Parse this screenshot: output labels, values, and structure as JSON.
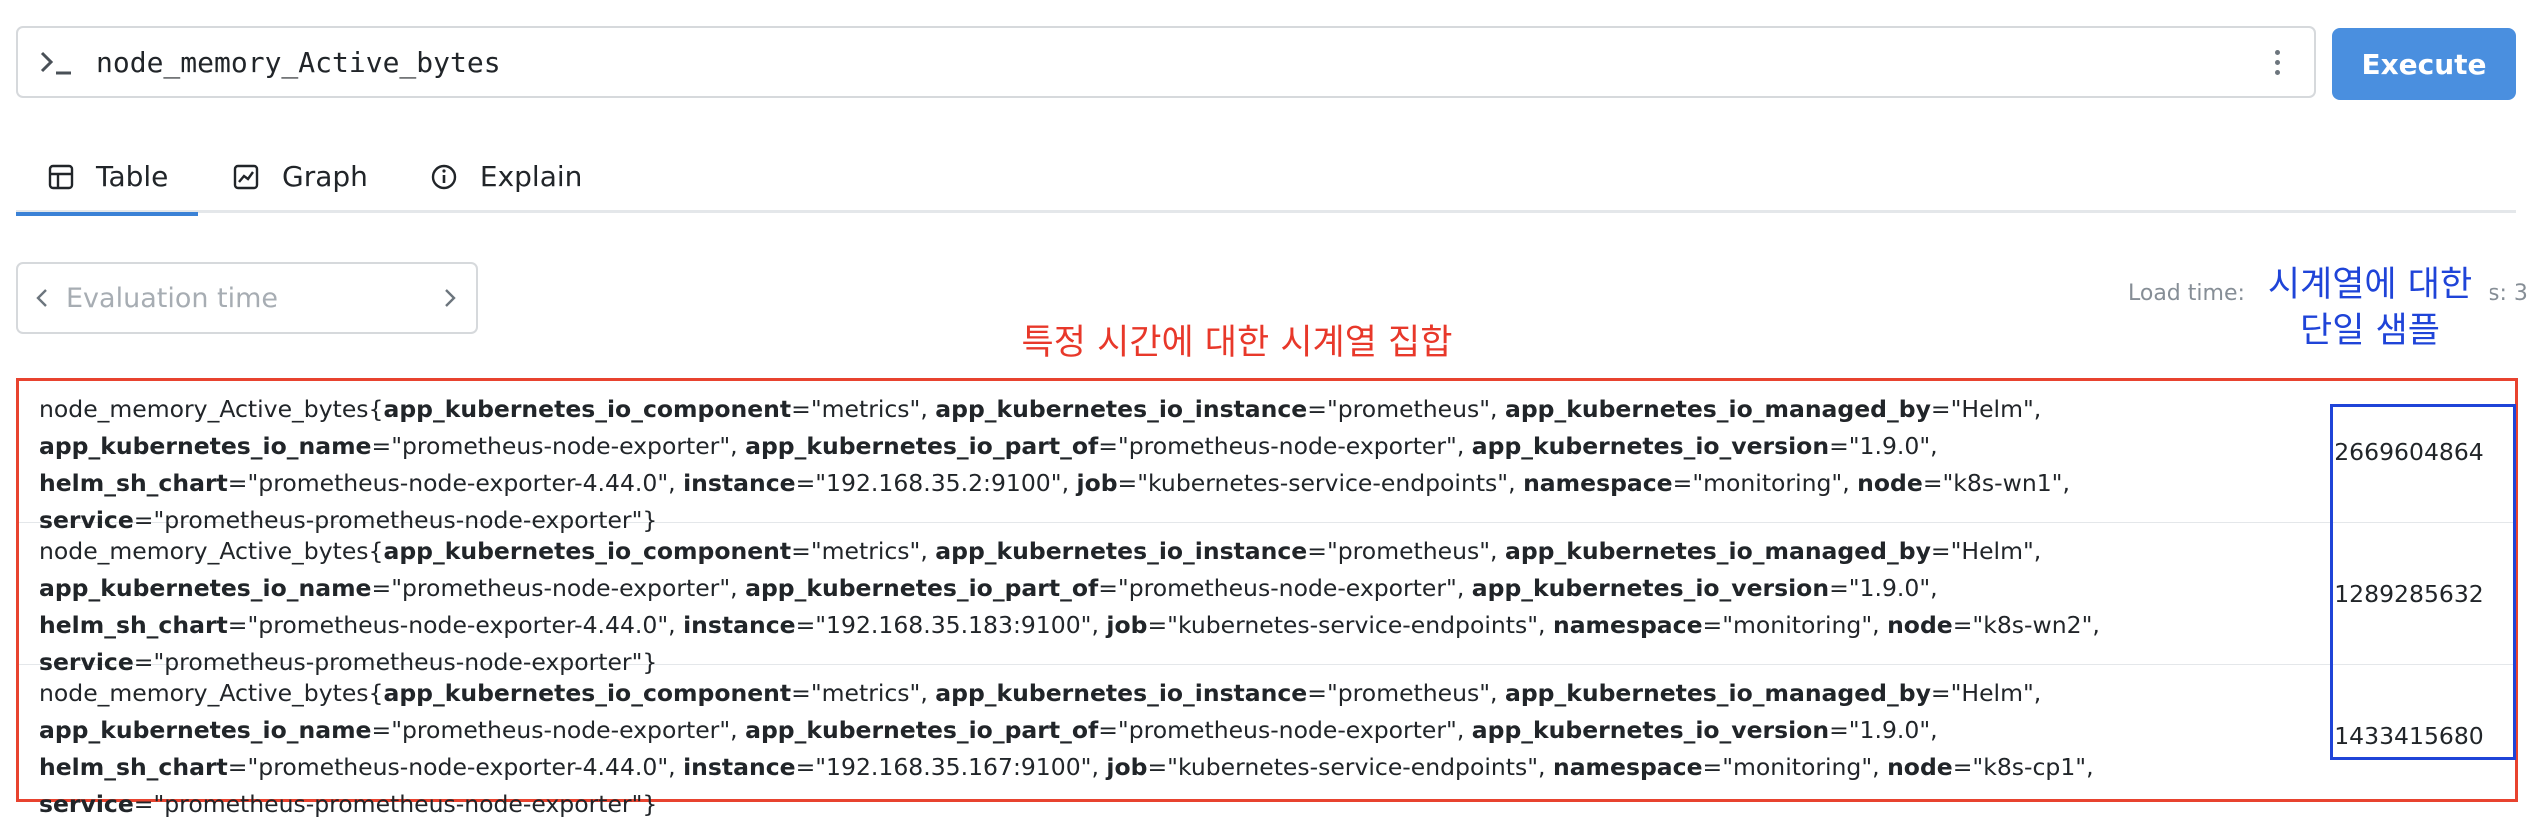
{
  "query": {
    "expression": "node_memory_Active_bytes",
    "execute_label": "Execute"
  },
  "tabs": [
    {
      "label": "Table",
      "icon": "table-icon",
      "active": true
    },
    {
      "label": "Graph",
      "icon": "graph-icon",
      "active": false
    },
    {
      "label": "Explain",
      "icon": "info-icon",
      "active": false
    }
  ],
  "evaluation": {
    "placeholder": "Evaluation time"
  },
  "stats": {
    "load_time_label": "Load time:",
    "result_series_tail": "s: 3"
  },
  "annotations": {
    "series_set": "특정 시간에 대한 시계열 집합",
    "single_sample_line1": "시계열에 대한",
    "single_sample_line2": "단일 샘플"
  },
  "rows": [
    {
      "metric": "node_memory_Active_bytes",
      "labels": [
        {
          "k": "app_kubernetes_io_component",
          "v": "metrics"
        },
        {
          "k": "app_kubernetes_io_instance",
          "v": "prometheus"
        },
        {
          "k": "app_kubernetes_io_managed_by",
          "v": "Helm"
        },
        {
          "k": "app_kubernetes_io_name",
          "v": "prometheus-node-exporter"
        },
        {
          "k": "app_kubernetes_io_part_of",
          "v": "prometheus-node-exporter"
        },
        {
          "k": "app_kubernetes_io_version",
          "v": "1.9.0"
        },
        {
          "k": "helm_sh_chart",
          "v": "prometheus-node-exporter-4.44.0"
        },
        {
          "k": "instance",
          "v": "192.168.35.2:9100"
        },
        {
          "k": "job",
          "v": "kubernetes-service-endpoints"
        },
        {
          "k": "namespace",
          "v": "monitoring"
        },
        {
          "k": "node",
          "v": "k8s-wn1"
        },
        {
          "k": "service",
          "v": "prometheus-prometheus-node-exporter"
        }
      ],
      "value": "2669604864"
    },
    {
      "metric": "node_memory_Active_bytes",
      "labels": [
        {
          "k": "app_kubernetes_io_component",
          "v": "metrics"
        },
        {
          "k": "app_kubernetes_io_instance",
          "v": "prometheus"
        },
        {
          "k": "app_kubernetes_io_managed_by",
          "v": "Helm"
        },
        {
          "k": "app_kubernetes_io_name",
          "v": "prometheus-node-exporter"
        },
        {
          "k": "app_kubernetes_io_part_of",
          "v": "prometheus-node-exporter"
        },
        {
          "k": "app_kubernetes_io_version",
          "v": "1.9.0"
        },
        {
          "k": "helm_sh_chart",
          "v": "prometheus-node-exporter-4.44.0"
        },
        {
          "k": "instance",
          "v": "192.168.35.183:9100"
        },
        {
          "k": "job",
          "v": "kubernetes-service-endpoints"
        },
        {
          "k": "namespace",
          "v": "monitoring"
        },
        {
          "k": "node",
          "v": "k8s-wn2"
        },
        {
          "k": "service",
          "v": "prometheus-prometheus-node-exporter"
        }
      ],
      "value": "1289285632"
    },
    {
      "metric": "node_memory_Active_bytes",
      "labels": [
        {
          "k": "app_kubernetes_io_component",
          "v": "metrics"
        },
        {
          "k": "app_kubernetes_io_instance",
          "v": "prometheus"
        },
        {
          "k": "app_kubernetes_io_managed_by",
          "v": "Helm"
        },
        {
          "k": "app_kubernetes_io_name",
          "v": "prometheus-node-exporter"
        },
        {
          "k": "app_kubernetes_io_part_of",
          "v": "prometheus-node-exporter"
        },
        {
          "k": "app_kubernetes_io_version",
          "v": "1.9.0"
        },
        {
          "k": "helm_sh_chart",
          "v": "prometheus-node-exporter-4.44.0"
        },
        {
          "k": "instance",
          "v": "192.168.35.167:9100"
        },
        {
          "k": "job",
          "v": "kubernetes-service-endpoints"
        },
        {
          "k": "namespace",
          "v": "monitoring"
        },
        {
          "k": "node",
          "v": "k8s-cp1"
        },
        {
          "k": "service",
          "v": "prometheus-prometheus-node-exporter"
        }
      ],
      "value": "1433415680"
    }
  ],
  "colors": {
    "accent": "#4a8fdf",
    "annotation_red": "#e8382a",
    "annotation_blue": "#1f44d8"
  }
}
